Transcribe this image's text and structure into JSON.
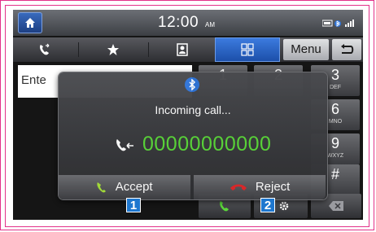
{
  "status_bar": {
    "clock": "12:00",
    "ampm": "AM"
  },
  "tabs": {
    "items": [
      {
        "icon": "recent-calls-icon"
      },
      {
        "icon": "star-icon"
      },
      {
        "icon": "contacts-icon"
      },
      {
        "icon": "dialpad-icon",
        "active": true
      }
    ],
    "menu_label": "Menu"
  },
  "dialer": {
    "input_value": "Ente",
    "keys": [
      {
        "digit": "1",
        "letters": ""
      },
      {
        "digit": "2",
        "letters": ""
      },
      {
        "digit": "3",
        "letters": "DEF"
      },
      {
        "digit": "6",
        "letters": "MNO"
      },
      {
        "digit": "9",
        "letters": "WXYZ"
      },
      {
        "digit": "#",
        "letters": ""
      }
    ]
  },
  "popup": {
    "title": "Incoming call...",
    "caller_number": "00000000000",
    "accept_label": "Accept",
    "reject_label": "Reject"
  },
  "callouts": [
    "1",
    "2"
  ],
  "colors": {
    "accent": "#2f74d8",
    "accept_green": "#5bd83a",
    "reject_red": "#e0282a",
    "frame_border": "#e2328a"
  }
}
